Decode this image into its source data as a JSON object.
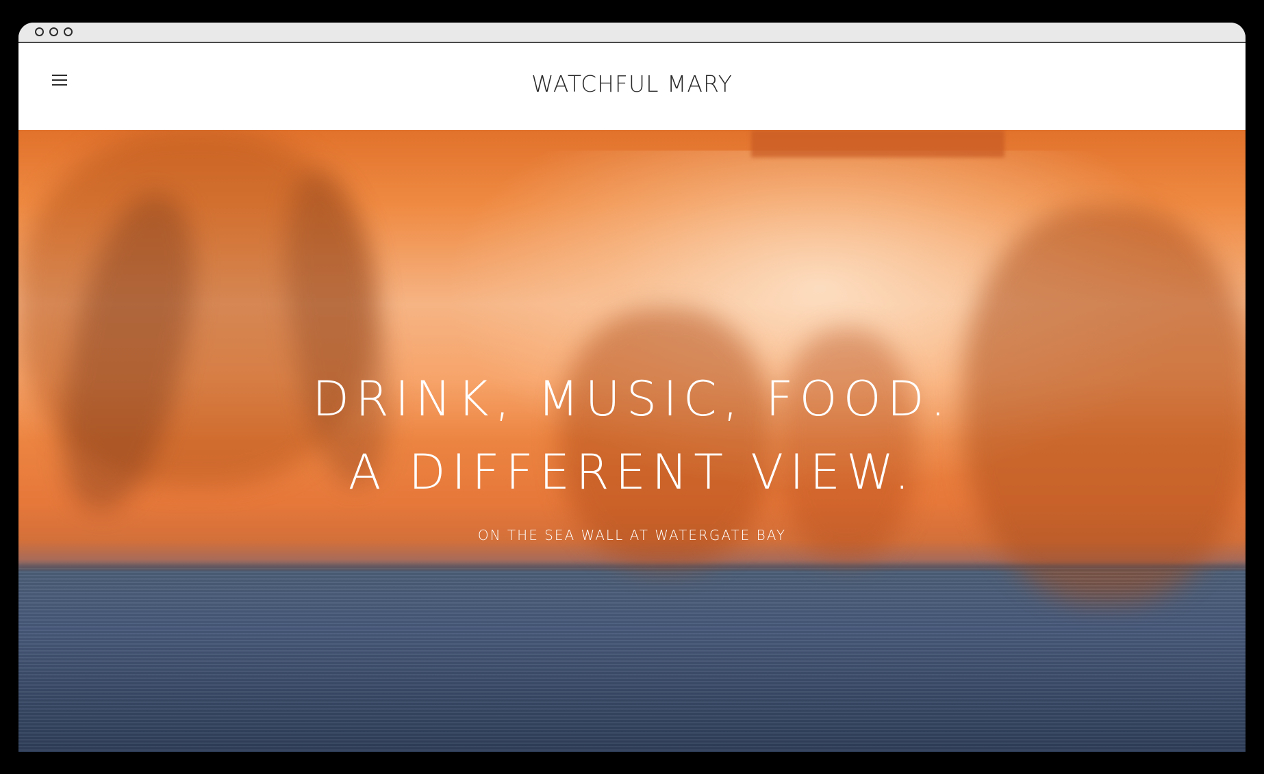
{
  "site": {
    "title": "WATCHFUL MARY",
    "menu_icon": "hamburger-menu-icon"
  },
  "hero": {
    "headline_line_1": "DRINK, MUSIC, FOOD.",
    "headline_line_2": "A DIFFERENT VIEW.",
    "subheadline": "ON THE SEA WALL AT WATERGATE BAY"
  },
  "colors": {
    "page_background": "#000000",
    "header_background": "#ffffff",
    "title_text": "#2a2a2a",
    "hero_text": "#ffffff",
    "sunset_orange": "#ec8441",
    "sea_blue": "#47597a"
  }
}
